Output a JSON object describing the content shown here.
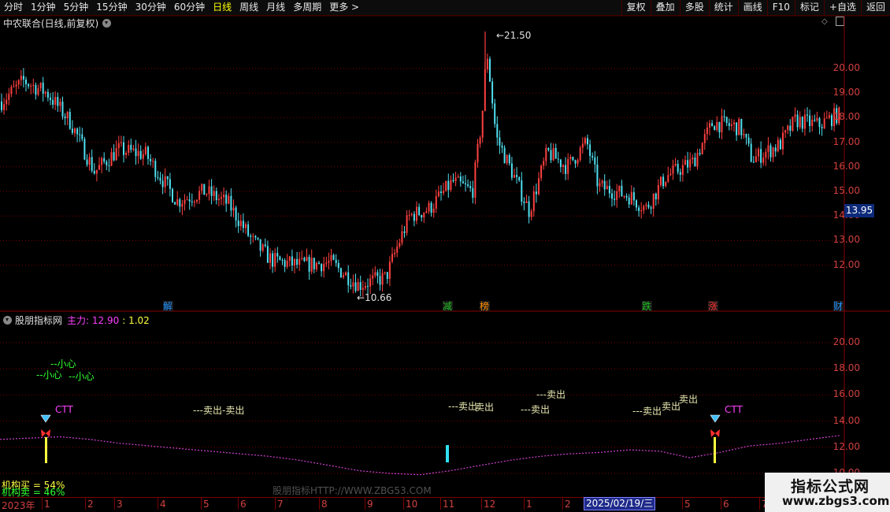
{
  "toolbar": {
    "left": [
      "分时",
      "1分钟",
      "5分钟",
      "15分钟",
      "30分钟",
      "60分钟",
      "日线",
      "周线",
      "月线",
      "多周期",
      "更多 >"
    ],
    "active": "日线",
    "right": [
      "复权",
      "叠加",
      "多股",
      "统计",
      "画线",
      "F10",
      "标记",
      "+自选",
      "返回"
    ]
  },
  "chart_title": "中农联合(日线,前复权)",
  "price_axis_labels": [
    "20.00",
    "19.00",
    "18.00",
    "17.00",
    "16.00",
    "15.00",
    "14.00",
    "13.00",
    "12.00"
  ],
  "last_price": "13.95",
  "max_label": "21.50",
  "min_label": "10.66",
  "event_markers": [
    {
      "text": "解",
      "color": "#1e90ff"
    },
    {
      "text": "减",
      "color": "#20c020"
    },
    {
      "text": "榜",
      "color": "#ff8c00"
    },
    {
      "text": "跌",
      "color": "#20c020"
    },
    {
      "text": "涨",
      "color": "#ff3030"
    },
    {
      "text": "财",
      "color": "#1e90ff"
    }
  ],
  "indicator": {
    "name": "股朋指标网",
    "main_label": "主力: 12.90",
    "second_label": ": 1.02",
    "axis_labels": [
      "20.00",
      "18.00",
      "16.00",
      "14.00",
      "12.00",
      "10.00"
    ],
    "annotations": [
      "--小心",
      "--小心",
      "--小心",
      "---卖出",
      "-卖出",
      "---卖出",
      "卖出",
      "---卖出",
      "---卖出",
      "---卖出",
      "卖出",
      "卖出",
      "CTT",
      "CTT"
    ]
  },
  "x_axis_labels": [
    "2023年",
    "1",
    "2",
    "3",
    "4",
    "5",
    "6",
    "7",
    "8",
    "9",
    "10",
    "11",
    "12",
    "1",
    "2",
    "3",
    "4",
    "5",
    "6",
    "7"
  ],
  "selected_date": "2025/02/19/三",
  "institution_buy": "机构买 = 54%",
  "institution_sell": "机构卖 = 46%",
  "watermark": "股朋指标HTTP://WWW.ZBG53.COM",
  "logo": {
    "title": "指标公式网",
    "url": "www.zbgs3.com"
  },
  "chart_data": {
    "type": "candlestick",
    "title": "中农联合(日线,前复权)",
    "y_range": [
      11.0,
      21.5
    ],
    "marked_max": 21.5,
    "marked_min": 10.66,
    "last_close": 13.95,
    "series": [
      {
        "name": "主力",
        "values": [
          12.6,
          12.7,
          12.8,
          12.6,
          12.3,
          12.1,
          11.9,
          11.7,
          11.5,
          11.3,
          11.0,
          10.6,
          10.2,
          10.0,
          9.9,
          10.2,
          10.6,
          11.0,
          11.3,
          11.5,
          11.6,
          11.8,
          11.7,
          11.2,
          11.6,
          12.1,
          12.3,
          12.6,
          12.9
        ]
      }
    ]
  }
}
